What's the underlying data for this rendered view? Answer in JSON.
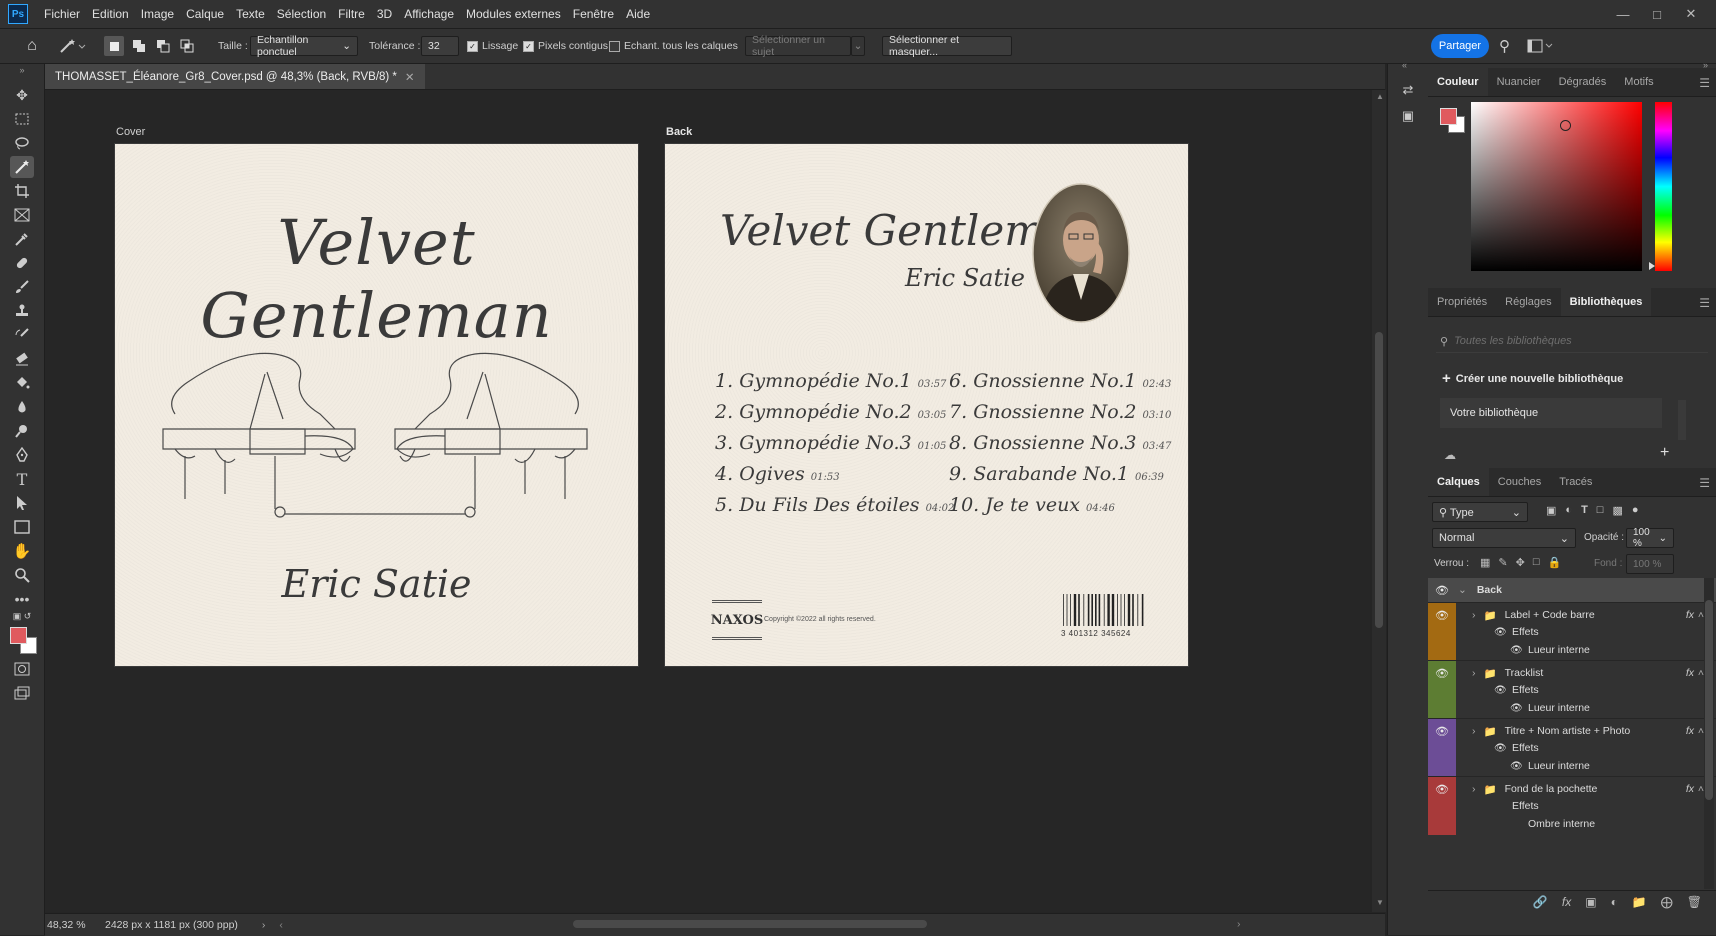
{
  "menubar": {
    "app_logo": "Ps",
    "items": [
      "Fichier",
      "Edition",
      "Image",
      "Calque",
      "Texte",
      "Sélection",
      "Filtre",
      "3D",
      "Affichage",
      "Modules externes",
      "Fenêtre",
      "Aide"
    ],
    "window_controls": [
      "minimize-icon",
      "maximize-icon",
      "close-icon"
    ]
  },
  "options_bar": {
    "taille_label": "Taille :",
    "taille_value": "Echantillon ponctuel",
    "tolerance_label": "Tolérance :",
    "tolerance_value": "32",
    "lissage": {
      "label": "Lissage",
      "checked": true
    },
    "pixels_contigus": {
      "label": "Pixels contigus",
      "checked": true
    },
    "echant": {
      "label": "Echant. tous les calques",
      "checked": false
    },
    "select_subject": "Sélectionner un sujet",
    "select_mask": "Sélectionner et masquer...",
    "share": "Partager"
  },
  "document": {
    "tab_title": "THOMASSET_Éléanore_Gr8_Cover.psd @ 48,3% (Back, RVB/8) *",
    "status_zoom": "48,32 %",
    "status_info": "2428 px x 1181 px (300 ppp)"
  },
  "artboards": {
    "cover": {
      "label": "Cover",
      "title": "Velvet Gentleman",
      "artist": "Eric Satie"
    },
    "back": {
      "label": "Back",
      "title": "Velvet Gentleman",
      "artist": "Eric Satie",
      "tracks_left": [
        {
          "n": "1.",
          "name": "Gymnopédie No.1",
          "time": "03:57"
        },
        {
          "n": "2.",
          "name": "Gymnopédie No.2",
          "time": "03:05"
        },
        {
          "n": "3.",
          "name": "Gymnopédie No.3",
          "time": "01:05"
        },
        {
          "n": "4.",
          "name": "Ogives",
          "time": "01:53"
        },
        {
          "n": "5.",
          "name": "Du Fils Des étoiles",
          "time": "04:02"
        }
      ],
      "tracks_right": [
        {
          "n": "6.",
          "name": "Gnossienne No.1",
          "time": "02:43"
        },
        {
          "n": "7.",
          "name": "Gnossienne No.2",
          "time": "03:10"
        },
        {
          "n": "8.",
          "name": "Gnossienne No.3",
          "time": "03:47"
        },
        {
          "n": "9.",
          "name": "Sarabande No.1",
          "time": "06:39"
        },
        {
          "n": "10.",
          "name": "Je te veux",
          "time": "04:46"
        }
      ],
      "label_logo": "NAXOS",
      "copyright": "Copyright ©2022 all rights reserved.",
      "barcode_number": "3 401312 345624"
    }
  },
  "color_panel": {
    "tabs": [
      "Couleur",
      "Nuancier",
      "Dégradés",
      "Motifs"
    ],
    "active_tab": "Couleur",
    "foreground": "#e05a5e",
    "background": "#ffffff"
  },
  "libraries_panel": {
    "tabs": [
      "Propriétés",
      "Réglages",
      "Bibliothèques"
    ],
    "active_tab": "Bibliothèques",
    "search_placeholder": "Toutes les bibliothèques",
    "create_label": "Créer une nouvelle bibliothèque",
    "library_item": "Votre bibliothèque"
  },
  "layers_panel": {
    "tabs": [
      "Calques",
      "Couches",
      "Tracés"
    ],
    "active_tab": "Calques",
    "filter_type": "Type",
    "blend_mode": "Normal",
    "opacity_label": "Opacité :",
    "opacity_value": "100 %",
    "lock_label": "Verrou :",
    "fill_label": "Fond :",
    "fill_value": "100 %",
    "root_group": "Back",
    "groups": [
      {
        "name": "Label + Code barre",
        "color": "#a36a12",
        "effects": "Effets",
        "effect": "Lueur interne"
      },
      {
        "name": "Tracklist",
        "color": "#5d7d33",
        "effects": "Effets",
        "effect": "Lueur interne"
      },
      {
        "name": "Titre + Nom artiste + Photo",
        "color": "#6c4d96",
        "effects": "Effets",
        "effect": "Lueur interne"
      },
      {
        "name": "Fond de la pochette",
        "color": "#a83a3a",
        "effects": "Effets",
        "effect": "Ombre interne"
      }
    ]
  }
}
